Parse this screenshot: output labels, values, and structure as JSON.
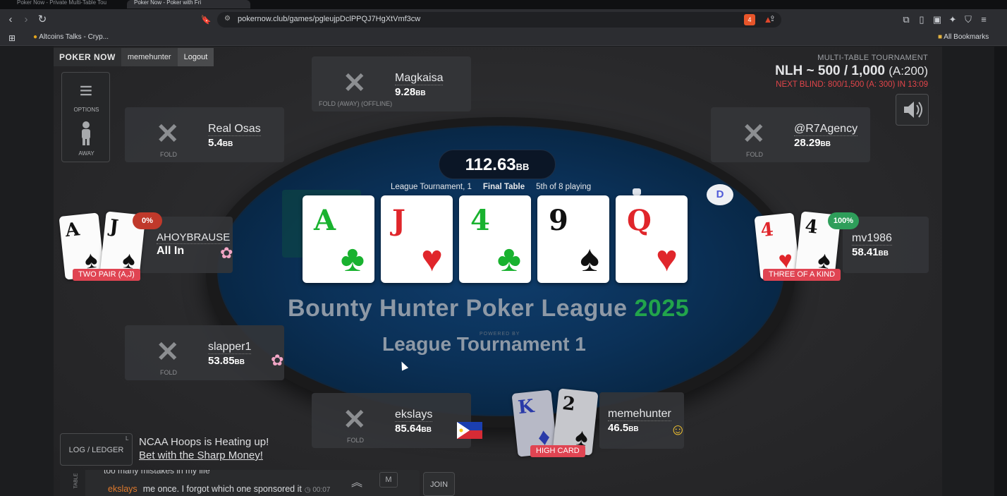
{
  "browser": {
    "tabs": [
      {
        "title": "Poker Now - Private Multi-Table Tou"
      },
      {
        "title": "Poker Now - Poker with Fri"
      }
    ],
    "url": "pokernow.club/games/pgleujpDclPPQJ7HgXtVmf3cw",
    "bookmarks": [
      {
        "label": "Altcoins Talks - Cryp..."
      }
    ],
    "all_bookmarks": "All Bookmarks",
    "extension_badges": [
      "4",
      "1"
    ]
  },
  "header": {
    "brand": "POKER NOW",
    "username": "memehunter",
    "logout": "Logout"
  },
  "side_menu": {
    "options": "OPTIONS",
    "away": "AWAY"
  },
  "tournament": {
    "type": "MULTI-TABLE TOURNAMENT",
    "blinds": "NLH ~ 500 / 1,000",
    "ante": "(A:200)",
    "next_blind": "NEXT BLIND: 800/1,500 (A: 300) IN 13:09"
  },
  "table": {
    "pot": "112.63",
    "pot_unit": "BB",
    "league": "League Tournament, 1",
    "stage": "Final Table",
    "place": "5th of 8 playing",
    "felt_title": "Bounty Hunter Poker League",
    "felt_year": "2025",
    "felt_subtitle": "League Tournament 1",
    "felt_powered": "POWERED BY",
    "dealer": "D",
    "board": [
      {
        "rank": "A",
        "suit": "♣",
        "color": "#19b22f"
      },
      {
        "rank": "J",
        "suit": "♥",
        "color": "#e0262b"
      },
      {
        "rank": "4",
        "suit": "♣",
        "color": "#19b22f"
      },
      {
        "rank": "9",
        "suit": "♠",
        "color": "#111111"
      },
      {
        "rank": "Q",
        "suit": "♥",
        "color": "#e0262b"
      }
    ]
  },
  "seats": {
    "magkaisa": {
      "name": "Magkaisa",
      "stack": "9.28",
      "unit": "BB",
      "status": "FOLD (AWAY) (OFFLINE)"
    },
    "real_osas": {
      "name": "Real Osas",
      "stack": "5.4",
      "unit": "BB",
      "status": "FOLD"
    },
    "r7agency": {
      "name": "@R7Agency",
      "stack": "28.29",
      "unit": "BB",
      "status": "FOLD"
    },
    "ahoybrause": {
      "name": "AHOYBRAUSE",
      "stack": "All In",
      "equity": "0%",
      "hand": "TWO PAIR (A,J)",
      "cards": [
        {
          "rank": "A",
          "suit": "♠"
        },
        {
          "rank": "J",
          "suit": "♠"
        }
      ]
    },
    "mv1986": {
      "name": "mv1986",
      "stack": "58.41",
      "unit": "BB",
      "equity": "100%",
      "hand": "THREE OF A KIND",
      "cards": [
        {
          "rank": "4",
          "suit": "♥"
        },
        {
          "rank": "4",
          "suit": "♠"
        }
      ]
    },
    "slapper1": {
      "name": "slapper1",
      "stack": "53.85",
      "unit": "BB",
      "status": "FOLD"
    },
    "ekslays": {
      "name": "ekslays",
      "stack": "85.64",
      "unit": "BB",
      "status": "FOLD"
    },
    "memehunter": {
      "name": "memehunter",
      "stack": "46.5",
      "unit": "BB",
      "hand": "HIGH CARD",
      "cards": [
        {
          "rank": "K",
          "suit": "♦"
        },
        {
          "rank": "2",
          "suit": "♠"
        }
      ]
    }
  },
  "bottom": {
    "log_button": "LOG / LEDGER",
    "log_key": "L",
    "promo_line1": "NCAA Hoops is Heating up!",
    "promo_line2": "Bet with the Sharp Money!",
    "chat_tab": "TABLE",
    "chat_prev": "too many mistakes in my life",
    "chat_user": "ekslays",
    "chat_message": "me once. I forgot which one sponsored it",
    "chat_time": "00:07",
    "m_button": "M",
    "join_button": "JOIN"
  }
}
